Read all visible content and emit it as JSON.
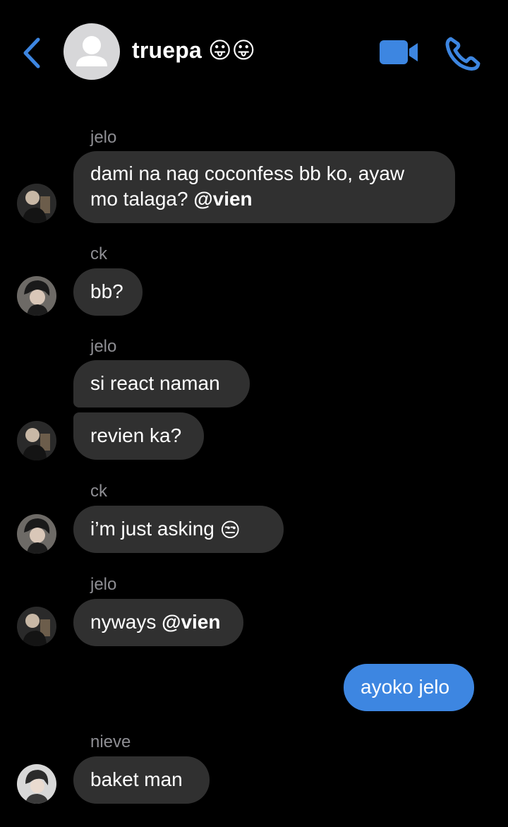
{
  "header": {
    "title": "truepa",
    "title_emojis": "😛😛",
    "back_icon": "chevron-left-icon",
    "video_icon": "video-camera-icon",
    "call_icon": "phone-icon",
    "accent_color": "#3d86e1"
  },
  "messages": [
    {
      "sender": "jelo",
      "text": "dami na nag coconfess bb ko, ayaw",
      "text2": "mo talaga?",
      "mention": "@vien"
    },
    {
      "sender": "ck",
      "text": "bb?"
    },
    {
      "sender": "jelo",
      "text": "si react naman"
    },
    {
      "text": "revien ka?"
    },
    {
      "sender": "ck",
      "text": "i’m just asking",
      "emoji": "😒"
    },
    {
      "sender": "jelo",
      "text": "nyways",
      "mention": "@vien"
    },
    {
      "text": "ayoko jelo",
      "outgoing": true
    },
    {
      "sender": "nieve",
      "text": "baket man"
    }
  ]
}
